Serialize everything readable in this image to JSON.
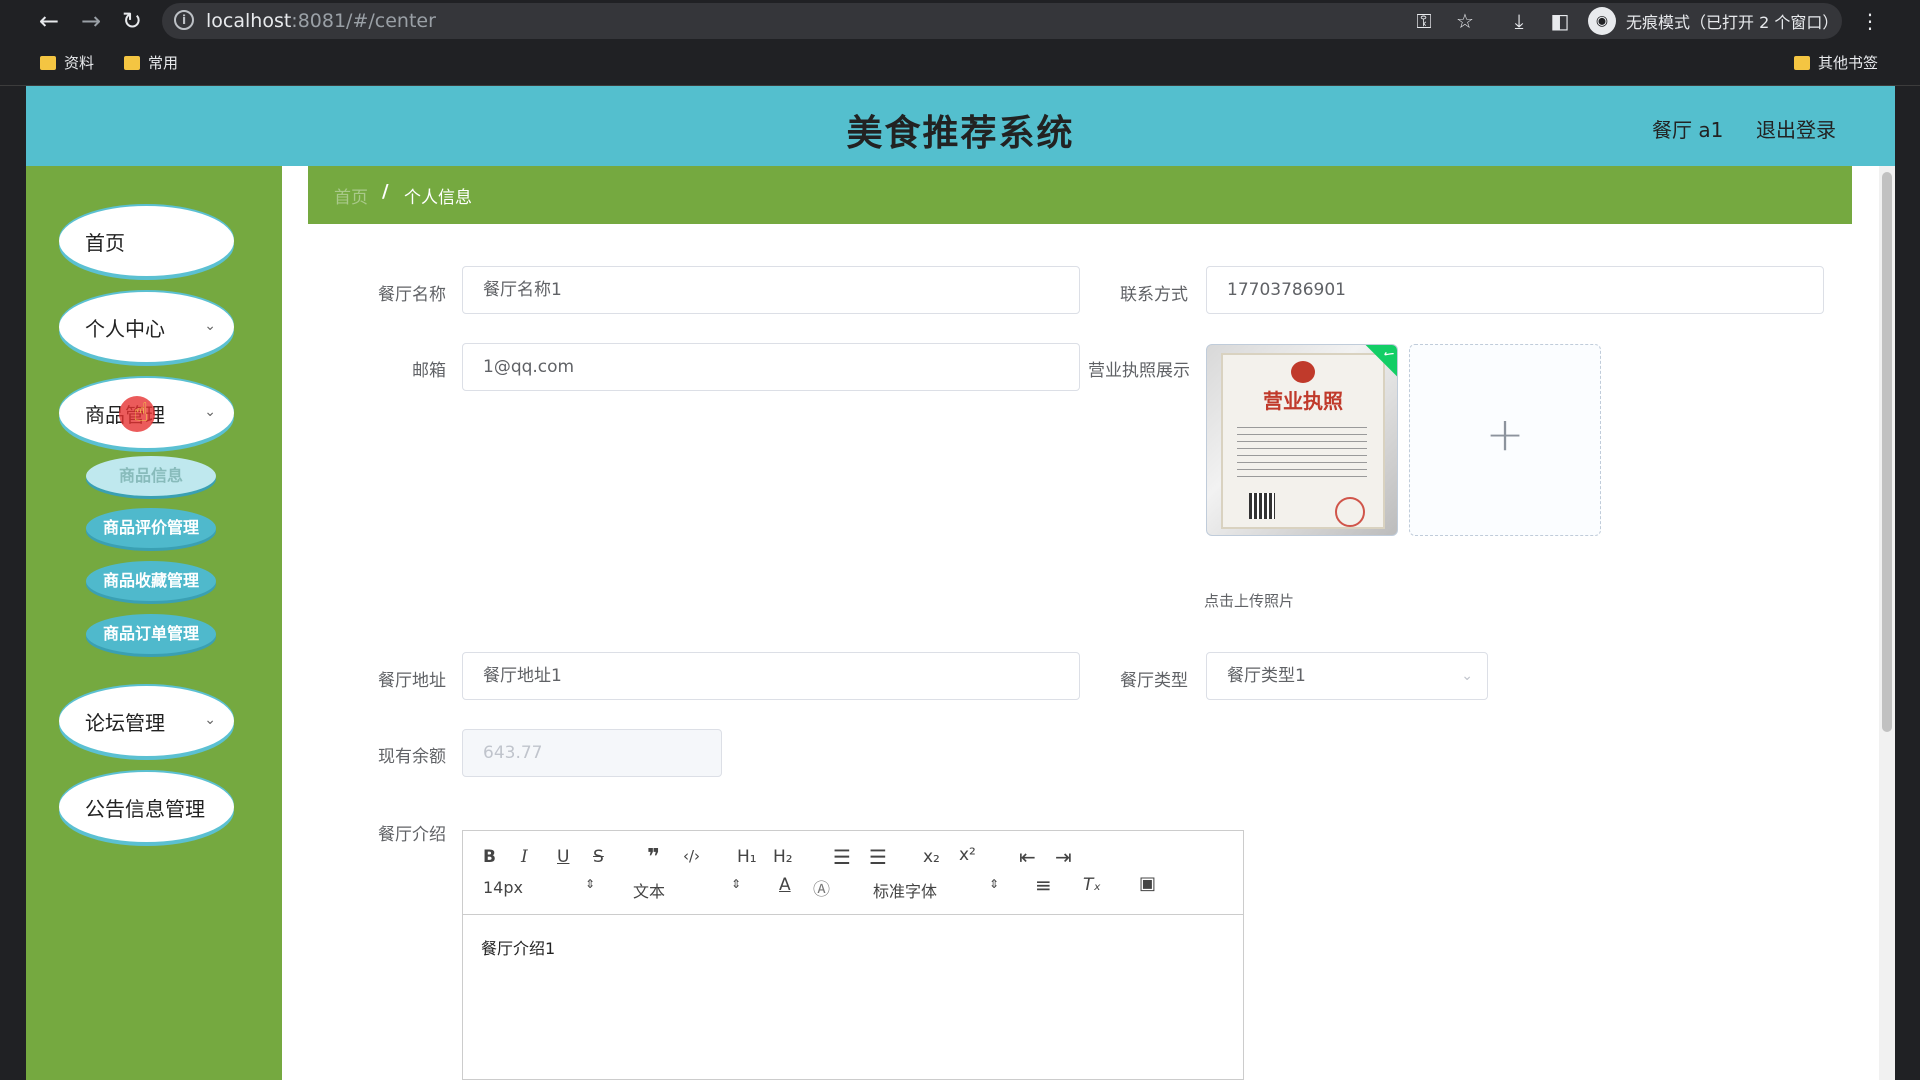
{
  "browser": {
    "url_host": "localhost",
    "url_rest": ":8081/#/center",
    "incognito_label": "无痕模式（已打开 2 个窗口）",
    "bookmarks": [
      "资料",
      "常用"
    ],
    "other_bookmarks": "其他书签"
  },
  "header": {
    "title": "美食推荐系统",
    "user": "餐厅 a1",
    "logout": "退出登录"
  },
  "sidebar": {
    "items": [
      {
        "label": "首页"
      },
      {
        "label": "个人中心"
      },
      {
        "label": "商品管理"
      },
      {
        "label": "论坛管理"
      },
      {
        "label": "公告信息管理"
      }
    ],
    "subitems": [
      "商品信息",
      "商品评价管理",
      "商品收藏管理",
      "商品订单管理"
    ]
  },
  "breadcrumb": {
    "home": "首页",
    "separator": "/",
    "current": "个人信息"
  },
  "form": {
    "name_label": "餐厅名称",
    "name_value": "餐厅名称1",
    "contact_label": "联系方式",
    "contact_value": "17703786901",
    "email_label": "邮箱",
    "email_value": "1@qq.com",
    "license_label": "营业执照展示",
    "license_image_text": "营业执照",
    "upload_tip": "点击上传照片",
    "address_label": "餐厅地址",
    "address_value": "餐厅地址1",
    "type_label": "餐厅类型",
    "type_value": "餐厅类型1",
    "balance_label": "现有余额",
    "balance_value": "643.77",
    "intro_label": "餐厅介绍"
  },
  "editor": {
    "size": "14px",
    "header": "文本",
    "font": "标准字体",
    "content": "餐厅介绍1"
  },
  "colors": {
    "header": "#54bfce",
    "sidebar": "#75a940",
    "breadcrumb": "#75a940"
  }
}
